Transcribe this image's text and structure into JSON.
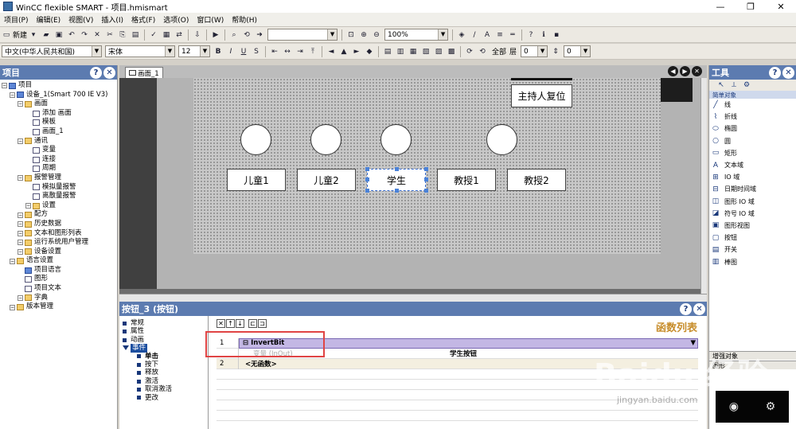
{
  "window": {
    "title": "WinCC flexible SMART - 项目.hmismart"
  },
  "menu": [
    "项目(P)",
    "编辑(E)",
    "视图(V)",
    "插入(I)",
    "格式(F)",
    "选项(O)",
    "窗口(W)",
    "帮助(H)"
  ],
  "toolbar": {
    "new_label": "新建",
    "zoom_value": "100%",
    "lang_value": "中文(中华人民共和国)",
    "font_value": "宋体",
    "size_value": "12",
    "all_label": "全部",
    "layer_label": "层",
    "layer_value": "0",
    "layer_value2": "0"
  },
  "project": {
    "title": "项目",
    "tree": [
      {
        "label": "项目",
        "depth": 0,
        "icon": "project"
      },
      {
        "label": "设备_1(Smart 700 IE V3)",
        "depth": 1,
        "icon": "device"
      },
      {
        "label": "画面",
        "depth": 2,
        "icon": "folder"
      },
      {
        "label": "添加 画面",
        "depth": 3,
        "icon": "add"
      },
      {
        "label": "模板",
        "depth": 3,
        "icon": "page"
      },
      {
        "label": "画面_1",
        "depth": 3,
        "icon": "page"
      },
      {
        "label": "通讯",
        "depth": 2,
        "icon": "folder"
      },
      {
        "label": "变量",
        "depth": 3,
        "icon": "page"
      },
      {
        "label": "连接",
        "depth": 3,
        "icon": "page"
      },
      {
        "label": "周期",
        "depth": 3,
        "icon": "page"
      },
      {
        "label": "报警管理",
        "depth": 2,
        "icon": "folder"
      },
      {
        "label": "模拟量报警",
        "depth": 3,
        "icon": "page"
      },
      {
        "label": "离散量报警",
        "depth": 3,
        "icon": "page"
      },
      {
        "label": "设置",
        "depth": 3,
        "icon": "folder"
      },
      {
        "label": "配方",
        "depth": 2,
        "icon": "folder"
      },
      {
        "label": "历史数据",
        "depth": 2,
        "icon": "folder"
      },
      {
        "label": "文本和图形列表",
        "depth": 2,
        "icon": "folder"
      },
      {
        "label": "运行系统用户管理",
        "depth": 2,
        "icon": "folder"
      },
      {
        "label": "设备设置",
        "depth": 2,
        "icon": "folder"
      },
      {
        "label": "语言设置",
        "depth": 1,
        "icon": "folder"
      },
      {
        "label": "项目语言",
        "depth": 2,
        "icon": "blue"
      },
      {
        "label": "图形",
        "depth": 2,
        "icon": "page"
      },
      {
        "label": "项目文本",
        "depth": 2,
        "icon": "page"
      },
      {
        "label": "字典",
        "depth": 2,
        "icon": "folder"
      },
      {
        "label": "版本管理",
        "depth": 1,
        "icon": "folder"
      }
    ]
  },
  "editor": {
    "tab_label": "画面_1",
    "buttons": {
      "host_reset": "主持人复位",
      "child1": "儿童1",
      "child2": "儿童2",
      "student": "学生",
      "professor1": "教授1",
      "professor2": "教授2"
    }
  },
  "properties": {
    "title": "按钮_3 (按钮)",
    "nav": [
      "常规",
      "属性",
      "动画",
      "事件"
    ],
    "events": [
      "单击",
      "按下",
      "释放",
      "激活",
      "取消激活",
      "更改"
    ],
    "function_list_label": "函数列表",
    "rows": [
      {
        "num": "1",
        "func": "InvertBit"
      },
      {
        "num": "",
        "param": "变量 (InOut)",
        "value": "学生按钮"
      },
      {
        "num": "2",
        "func": "<无函数>"
      }
    ]
  },
  "tools": {
    "title": "工具",
    "section_simple": "简单对象",
    "items": [
      "线",
      "折线",
      "椭圆",
      "圆",
      "矩形",
      "文本域",
      "IO 域",
      "日期时间域",
      "图形 IO 域",
      "符号 IO 域",
      "图形视图",
      "按钮",
      "开关",
      "棒图"
    ],
    "section_enhanced": "增强对象",
    "section_graphics": "图形"
  },
  "watermark": {
    "brand": "Baidu 经验",
    "url": "jingyan.baidu.com"
  }
}
